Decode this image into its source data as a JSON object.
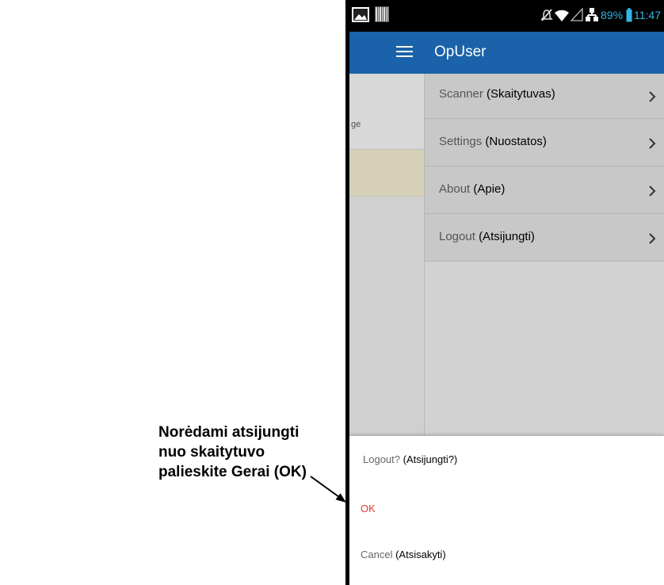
{
  "callout": {
    "line1": "Norėdami atsijungti",
    "line2": "nuo skaitytuvo",
    "line3": "palieskite Gerai (OK)"
  },
  "status_bar": {
    "left_icons": [
      "image-icon",
      "barcode-icon"
    ],
    "right_icons": [
      "notifications-off-icon",
      "wifi-icon",
      "signal-icon",
      "network-icon",
      "battery-icon"
    ],
    "battery_level": "89%",
    "time": "11:47",
    "accent_color": "#33b5e5"
  },
  "app_bar": {
    "title": "OpUser",
    "menu_icon": "hamburger-icon",
    "color": "#1a62a9"
  },
  "background_page": {
    "fragment_text": "ge"
  },
  "drawer": {
    "items": [
      {
        "label": "Scanner",
        "translation": "(Skaitytuvas)",
        "icon": "chevron-right-icon"
      },
      {
        "label": "Settings",
        "translation": "(Nuostatos)",
        "icon": "chevron-right-icon"
      },
      {
        "label": "About",
        "translation": "(Apie)",
        "icon": "chevron-right-icon"
      },
      {
        "label": "Logout",
        "translation": "(Atsijungti)",
        "icon": "chevron-right-icon"
      }
    ]
  },
  "dialog": {
    "title": "Logout?",
    "title_translation": "(Atsijungti?)",
    "ok_label": "OK",
    "ok_color": "#e53935",
    "cancel_label": "Cancel",
    "cancel_translation": "(Atsisakyti)"
  }
}
